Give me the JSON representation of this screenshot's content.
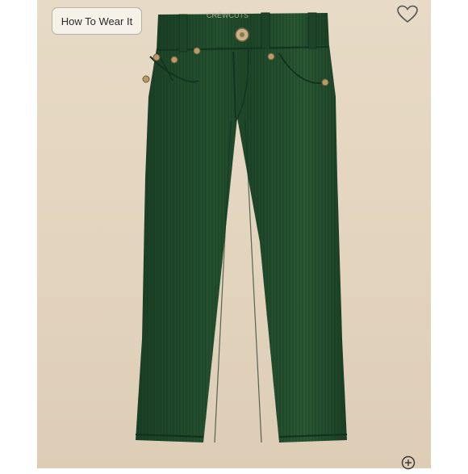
{
  "overlay": {
    "how_to_wear_label": "How To Wear It"
  },
  "icons": {
    "favorite": "heart-outline-icon",
    "zoom": "zoom-in-icon"
  },
  "product": {
    "image_subject": "green corduroy pants",
    "brand_tag_text": "CREWCUTS"
  },
  "colors": {
    "background_panel": "#e5d7c2",
    "garment": "#1f4a2c",
    "rivets": "#b59a6a"
  }
}
